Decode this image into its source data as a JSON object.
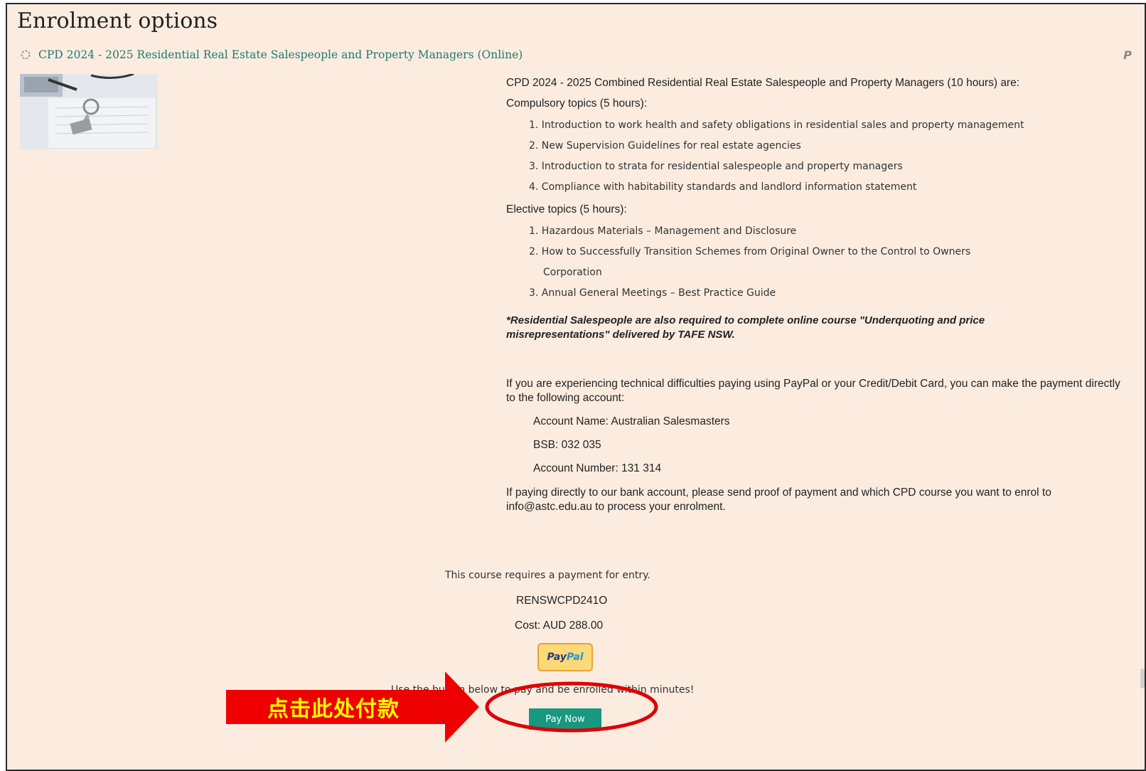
{
  "page": {
    "title": "Enrolment options",
    "course_link": "CPD 2024 - 2025 Residential Real Estate Salespeople and Property Managers (Online)",
    "corner_logo": "P",
    "thumbnail": "keys-on-documents-image"
  },
  "summary": {
    "intro": "CPD 2024 - 2025 Combined Residential Real Estate Salespeople and Property Managers (10 hours) are:",
    "compulsory_heading": "Compulsory topics (5 hours):",
    "compulsory_topics": [
      "1. Introduction to work health and safety obligations in residential sales and property management",
      "2. New Supervision Guidelines for real estate agencies",
      "3. Introduction to strata for residential salespeople and property managers",
      "4. Compliance with habitability standards and landlord information statement"
    ],
    "elective_heading": "Elective topics (5 hours):",
    "elective_topics": [
      {
        "text": "1. Hazardous Materials – Management and Disclosure",
        "cont": ""
      },
      {
        "text": "2. How to Successfully Transition Schemes from Original Owner to the Control to Owners",
        "cont": "Corporation"
      },
      {
        "text": "3. Annual General Meetings – Best Practice Guide",
        "cont": ""
      }
    ],
    "note": "*Residential Salespeople are also required to complete online course \"Underquoting and price misrepresentations\" delivered by TAFE NSW.",
    "difficulty_text": "If you are experiencing technical difficulties paying using PayPal or your Credit/Debit Card, you can make the payment directly to the following account:",
    "account_name": "Account Name: Australian Salesmasters",
    "bsb": "BSB: 032 035",
    "account_number": "Account Number: 131 314",
    "bank_instructions": "If paying directly to our bank account, please send proof of payment and which CPD course you want to enrol to info@astc.edu.au to process your enrolment."
  },
  "payment": {
    "requires_text": "This course requires a payment for entry.",
    "code": "RENSWCPD241O",
    "cost": "Cost: AUD 288.00",
    "paypal_logo_part1": "Pay",
    "paypal_logo_part2": "Pal",
    "instructions": "Use the button below to pay and be enrolled within minutes!",
    "pay_button": "Pay Now"
  },
  "annotation": {
    "label": "点击此处付款",
    "arrow_color": "#ee0000",
    "label_color": "#ffff00",
    "ellipse_color": "#dd0000"
  },
  "colors": {
    "background": "#fcece0",
    "link": "#1f7a6d",
    "button": "#179880"
  }
}
